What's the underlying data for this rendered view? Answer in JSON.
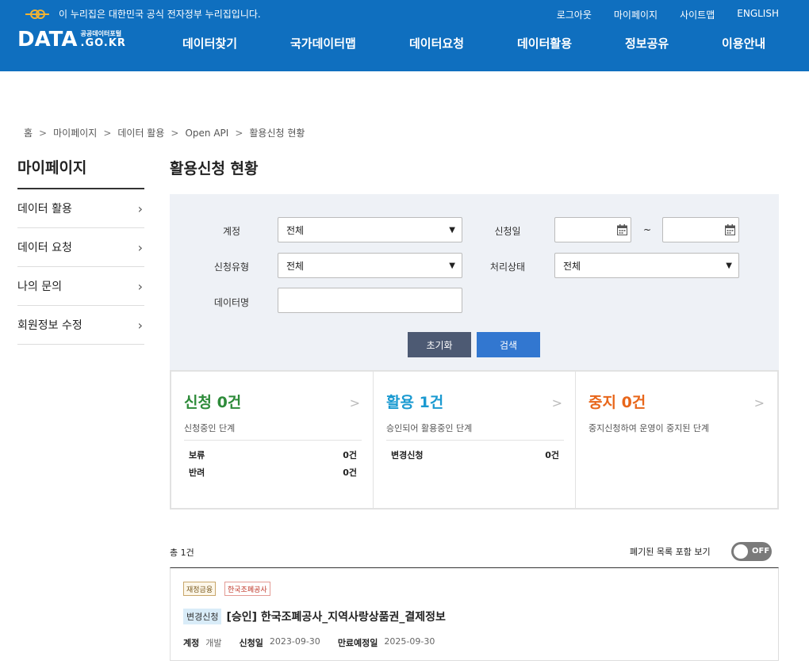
{
  "header": {
    "gov_banner": "이 누리집은 대한민국 공식 전자정부 누리집입니다.",
    "util_links": [
      "로그아웃",
      "마이페이지",
      "사이트맵",
      "ENGLISH"
    ],
    "brand": {
      "data": "DATA",
      "small": "공공데이터포털",
      "gokr": ".GO.KR"
    },
    "nav": [
      "데이터찾기",
      "국가데이터맵",
      "데이터요청",
      "데이터활용",
      "정보공유",
      "이용안내"
    ]
  },
  "breadcrumb": [
    "홈",
    "마이페이지",
    "데이터 활용",
    "Open API",
    "활용신청 현황"
  ],
  "sidebar": {
    "title": "마이페이지",
    "items": [
      {
        "label": "데이터 활용"
      },
      {
        "label": "데이터 요청"
      },
      {
        "label": "나의 문의"
      },
      {
        "label": "회원정보 수정"
      }
    ]
  },
  "page_title": "활용신청 현황",
  "search": {
    "account_label": "계정",
    "account_value": "전체",
    "apply_date_label": "신청일",
    "tilde": "~",
    "apply_type_label": "신청유형",
    "apply_type_value": "전체",
    "status_label": "처리상태",
    "status_value": "전체",
    "data_name_label": "데이터명",
    "data_name_value": "",
    "reset_label": "초기화",
    "search_label": "검색"
  },
  "cards": [
    {
      "title": "신청 0건",
      "desc": "신청중인 단계",
      "rows": [
        {
          "k": "보류",
          "v": "0건"
        },
        {
          "k": "반려",
          "v": "0건"
        }
      ]
    },
    {
      "title": "활용 1건",
      "desc": "승인되어 활용중인 단계",
      "rows": [
        {
          "k": "변경신청",
          "v": "0건"
        }
      ]
    },
    {
      "title": "중지 0건",
      "desc": "중지신청하여 운영이 중지된 단계",
      "rows": []
    }
  ],
  "card_arrow": ">",
  "list": {
    "total": "총 1건",
    "toggle_label": "폐기된 목록 포함 보기",
    "toggle_state": "OFF",
    "items": [
      {
        "tag1": "재정금융",
        "tag2": "한국조폐공사",
        "chip": "변경신청",
        "title": "[승인] 한국조폐공사_지역사랑상품권_결제정보",
        "account_k": "계정",
        "account_v": "개발",
        "apply_k": "신청일",
        "apply_v": "2023-09-30",
        "expire_k": "만료예정일",
        "expire_v": "2025-09-30"
      }
    ]
  },
  "colors": {
    "header_bg": "#0f6fbf",
    "apply": "#2e8b3a",
    "use": "#1b9ad1",
    "stop": "#e8661a"
  }
}
